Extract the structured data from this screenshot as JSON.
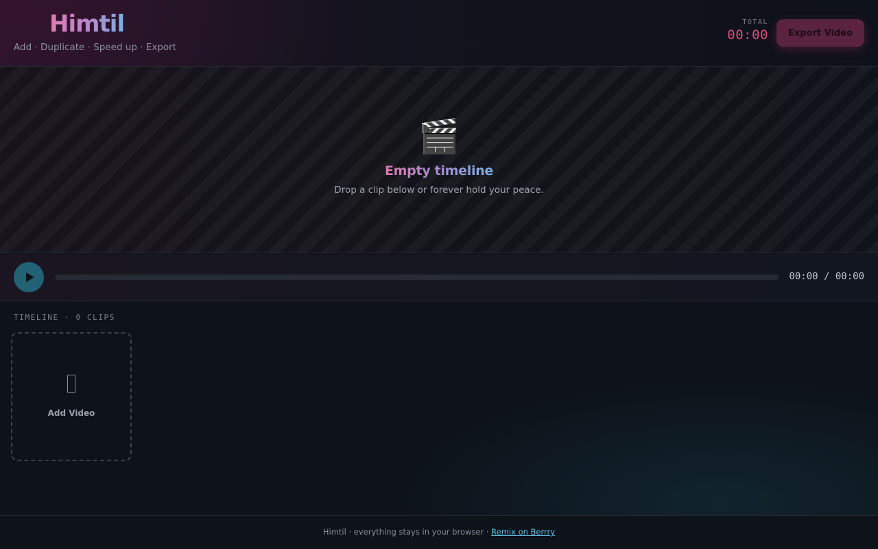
{
  "header": {
    "logo": "Himtil",
    "tagline": "Add · Duplicate · Speed up · Export",
    "total_label": "TOTAL",
    "total_value": "00:00",
    "export_label": "Export Video"
  },
  "stage": {
    "icon": "🎬",
    "icon_name": "clapperboard-icon",
    "title": "Empty timeline",
    "subtitle": "Drop a clip below or forever hold your peace."
  },
  "player": {
    "play_icon": "play-icon",
    "progress": 0,
    "time_readout": "00:00 / 00:00"
  },
  "timeline": {
    "label": "TIMELINE · 0 CLIPS",
    "add_label": "Add Video"
  },
  "footer": {
    "text": "Himtil · everything stays in your browser · ",
    "link": "Remix on Berrry"
  },
  "colors": {
    "accent_pink": "#e8497e",
    "play_button": "#236174",
    "link": "#5fc3e4"
  }
}
